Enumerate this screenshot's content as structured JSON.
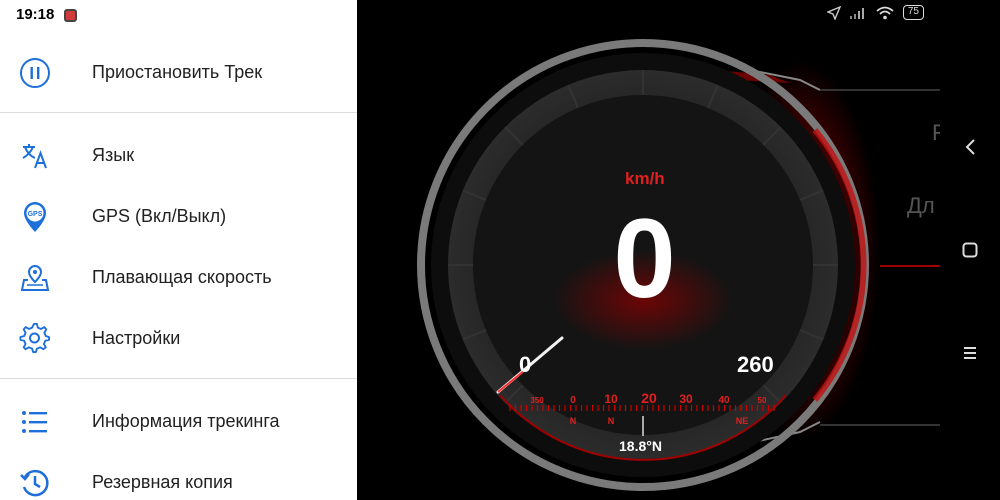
{
  "status_bar": {
    "time": "19:18",
    "battery": "75"
  },
  "drawer": {
    "items": [
      {
        "label": "Приостановить Трек",
        "icon": "pause-icon"
      },
      {
        "label": "Язык",
        "icon": "translate-icon"
      },
      {
        "label": "GPS (Вкл/Выкл)",
        "icon": "gps-pin-icon",
        "icon_text": "GPS"
      },
      {
        "label": "Плавающая скорость",
        "icon": "map-pin-icon"
      },
      {
        "label": "Настройки",
        "icon": "gear-icon"
      },
      {
        "label": "Информация трекинга",
        "icon": "list-icon"
      },
      {
        "label": "Резервная копия",
        "icon": "history-icon"
      }
    ]
  },
  "speedometer": {
    "speed": "0",
    "unit": "km/h",
    "min_label": "0",
    "max_label": "260",
    "compass": {
      "ticks": [
        "350",
        "0",
        "10",
        "20",
        "30",
        "40",
        "50"
      ],
      "dir_labels": [
        "N",
        "N",
        "NE"
      ],
      "heading": "18.8°N"
    }
  },
  "right_panel": {
    "partial_text_1": "F",
    "partial_text_2": "Дл"
  },
  "colors": {
    "accent_blue": "#1e6fd9",
    "accent_red": "#e0201f"
  }
}
